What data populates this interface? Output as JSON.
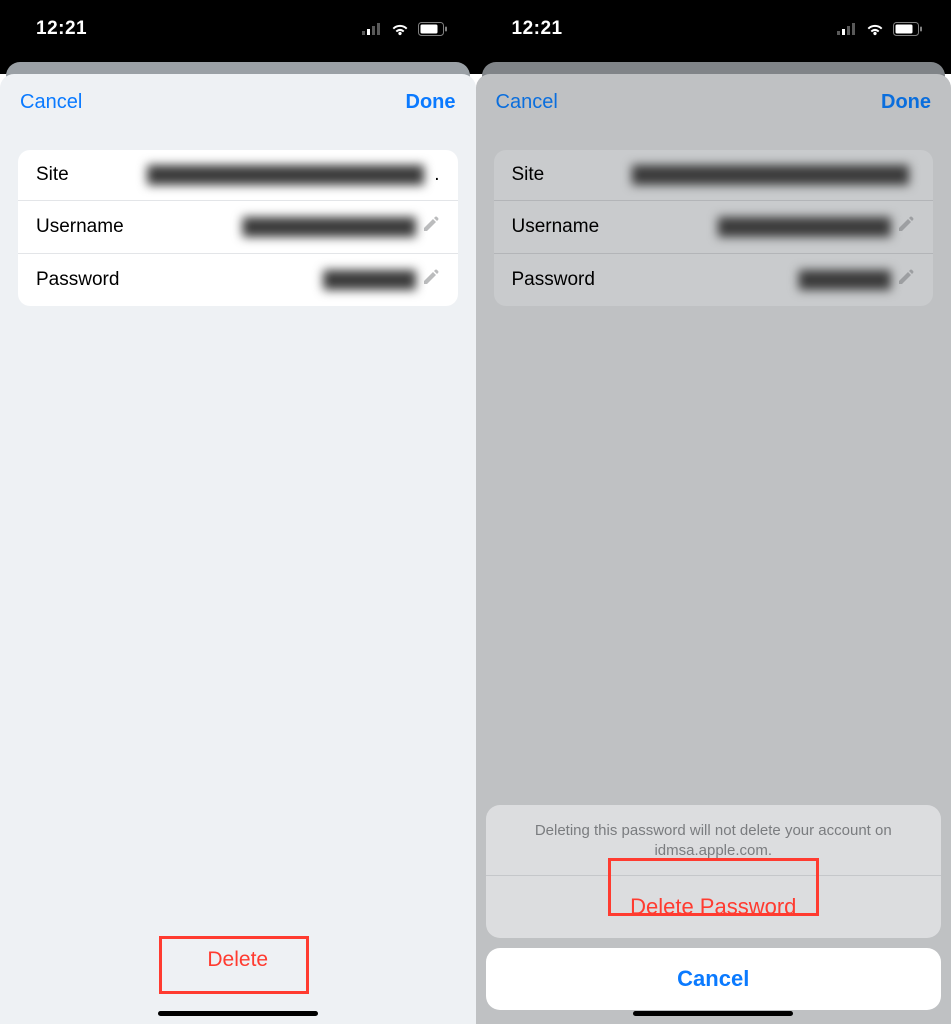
{
  "status": {
    "time": "12:21"
  },
  "left": {
    "nav": {
      "cancel": "Cancel",
      "done": "Done"
    },
    "fields": {
      "site_label": "Site",
      "site_value": "████████████████████████",
      "username_label": "Username",
      "username_value": "███████████████",
      "password_label": "Password",
      "password_value": "████████"
    },
    "delete_label": "Delete"
  },
  "right": {
    "nav": {
      "cancel": "Cancel",
      "done": "Done"
    },
    "fields": {
      "site_label": "Site",
      "site_value": "████████████████████████",
      "username_label": "Username",
      "username_value": "███████████████",
      "password_label": "Password",
      "password_value": "████████"
    },
    "action_sheet": {
      "message": "Deleting this password will not delete your account on idmsa.apple.com.",
      "delete_password": "Delete Password",
      "cancel": "Cancel"
    }
  }
}
